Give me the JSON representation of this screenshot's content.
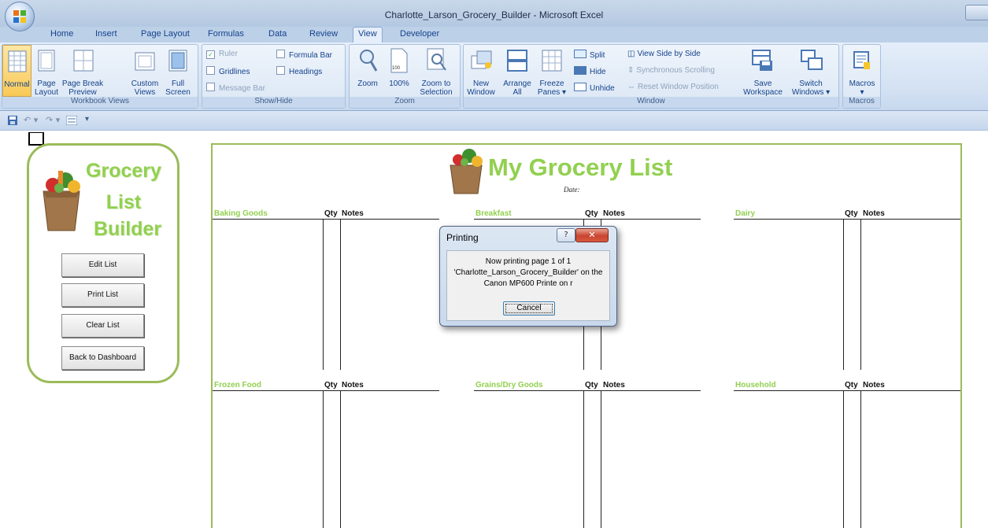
{
  "window": {
    "title": "Charlotte_Larson_Grocery_Builder - Microsoft Excel"
  },
  "tabs": [
    "Home",
    "Insert",
    "Page Layout",
    "Formulas",
    "Data",
    "Review",
    "View",
    "Developer"
  ],
  "active_tab": "View",
  "ribbon": {
    "workbook_views": {
      "label": "Workbook Views",
      "normal": "Normal",
      "page_layout_1": "Page",
      "page_layout_2": "Layout",
      "page_break_1": "Page Break",
      "page_break_2": "Preview",
      "custom_views_1": "Custom",
      "custom_views_2": "Views",
      "full_screen_1": "Full",
      "full_screen_2": "Screen"
    },
    "show_hide": {
      "label": "Show/Hide",
      "ruler": "Ruler",
      "formula_bar": "Formula Bar",
      "gridlines": "Gridlines",
      "headings": "Headings",
      "message_bar": "Message Bar"
    },
    "zoom": {
      "label": "Zoom",
      "zoom": "Zoom",
      "hundred": "100%",
      "zoom_sel_1": "Zoom to",
      "zoom_sel_2": "Selection",
      "hundred_icon_text": "100"
    },
    "window": {
      "label": "Window",
      "new_window_1": "New",
      "new_window_2": "Window",
      "arrange_1": "Arrange",
      "arrange_2": "All",
      "freeze_1": "Freeze",
      "freeze_2": "Panes ▾",
      "split": "Split",
      "hide": "Hide",
      "unhide": "Unhide",
      "side_by_side": "View Side by Side",
      "sync_scroll": "Synchronous Scrolling",
      "reset_pos": "Reset Window Position",
      "save_ws_1": "Save",
      "save_ws_2": "Workspace",
      "switch_1": "Switch",
      "switch_2": "Windows ▾"
    },
    "macros": {
      "label": "Macros",
      "macros": "Macros"
    }
  },
  "qat": {
    "arrow": "▾"
  },
  "panel": {
    "title_1": "Grocery",
    "title_2": "List",
    "title_3": "Builder",
    "buttons": [
      "Edit List",
      "Print List",
      "Clear List",
      "Back to Dashboard"
    ]
  },
  "list": {
    "title": "My Grocery List",
    "date_label": "Date:",
    "qty_label": "Qty",
    "notes_label": "Notes",
    "categories": [
      "Baking Goods",
      "Breakfast",
      "Dairy",
      "Frozen Food",
      "Grains/Dry Goods",
      "Household"
    ]
  },
  "dialog": {
    "title": "Printing",
    "help": "?",
    "close": "✕",
    "line1": "Now printing page 1 of 1",
    "line2": "'Charlotte_Larson_Grocery_Builder' on the",
    "line3": "Canon MP600 Printe    on r",
    "cancel": "Cancel"
  },
  "colors": {
    "accent_green": "#92d050",
    "border_green": "#9bbb59",
    "ribbon_blue": "#15428b"
  }
}
